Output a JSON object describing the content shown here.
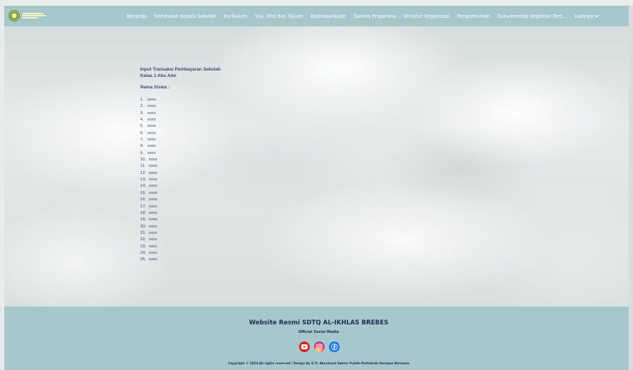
{
  "nav": {
    "logo_alt": "SDTQ AL-IKHLAS BREBES logo",
    "items": [
      "Beranda",
      "Sambutan Kepala Sekolah",
      "Kurikulum",
      "Visi, Misi dan Tujuan",
      "Ekstrakurikuler",
      "Sarana Prasarana",
      "Struktur Organisasi",
      "Pengumuman",
      "Dokumentasi Kegiatan Terb..."
    ],
    "more_label": "Lainnya"
  },
  "content": {
    "title": "Input Transaksi Pembayaran Sekolah",
    "class_name": "Kelas 1 Abu Amr",
    "nama_label": "Nama Siswa :",
    "students": [
      {
        "num": "1.",
        "name": "xxxx"
      },
      {
        "num": "2.",
        "name": "xxxx"
      },
      {
        "num": "3.",
        "name": "xxxx"
      },
      {
        "num": "4.",
        "name": "xxxx"
      },
      {
        "num": "5.",
        "name": "xxxx"
      },
      {
        "num": "6.",
        "name": "xxxx"
      },
      {
        "num": "7.",
        "name": "xxxx"
      },
      {
        "num": "8.",
        "name": "xxxx"
      },
      {
        "num": "9.",
        "name": "xxxx"
      },
      {
        "num": "10.",
        "name": "xxxx"
      },
      {
        "num": "11.",
        "name": "xxxx"
      },
      {
        "num": "12.",
        "name": "xxxx"
      },
      {
        "num": "13.",
        "name": "xxxx"
      },
      {
        "num": "14.",
        "name": "xxxx"
      },
      {
        "num": "15.",
        "name": "xxxx"
      },
      {
        "num": "16.",
        "name": "xxxx"
      },
      {
        "num": "17.",
        "name": "xxxx"
      },
      {
        "num": "18.",
        "name": "xxxx"
      },
      {
        "num": "19.",
        "name": "xxxx"
      },
      {
        "num": "20.",
        "name": "xxxx"
      },
      {
        "num": "21.",
        "name": "xxxx"
      },
      {
        "num": "22.",
        "name": "xxxx"
      },
      {
        "num": "23.",
        "name": "xxxx"
      },
      {
        "num": "24.",
        "name": "xxxx"
      },
      {
        "num": "25.",
        "name": "xxxx"
      }
    ]
  },
  "footer": {
    "title": "Website Resmi SDTQ AL-IKHLAS BREBES",
    "subtitle": "Official Sosial Media",
    "social": [
      "youtube-icon",
      "instagram-icon",
      "facebook-icon"
    ],
    "copyright": "Copyright © 2024  All rights reserved | Design By S.Tr. Akuntansi Sektor Publik-Politeknik Harapan Bersama"
  },
  "colors": {
    "nav_bg": "#a6c7cb",
    "footer_bg": "#a6c7cb",
    "text_dark": "#3b4a72",
    "youtube": "#e02020",
    "facebook": "#1877f2"
  }
}
